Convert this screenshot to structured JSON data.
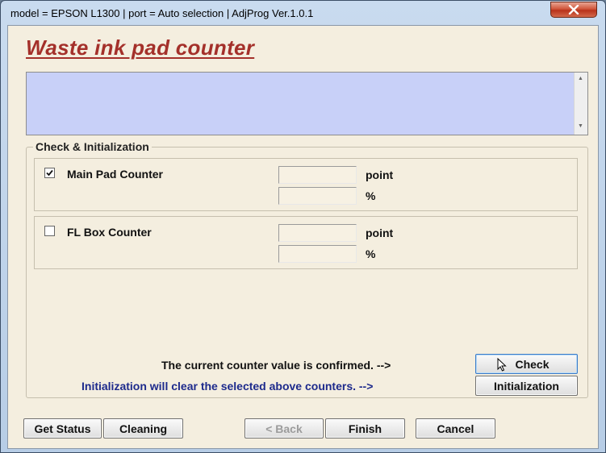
{
  "window": {
    "title": "model = EPSON L1300 | port = Auto selection | AdjProg Ver.1.0.1",
    "close_icon": "close-icon"
  },
  "page": {
    "heading": "Waste ink pad counter",
    "info_text": ""
  },
  "group": {
    "title": "Check & Initialization",
    "counters": [
      {
        "label": "Main Pad Counter",
        "checked": true,
        "point_value": "",
        "percent_value": "",
        "point_unit": "point",
        "percent_unit": "%"
      },
      {
        "label": "FL Box Counter",
        "checked": false,
        "point_value": "",
        "percent_value": "",
        "point_unit": "point",
        "percent_unit": "%"
      }
    ],
    "check_message": "The current counter value is confirmed. -->",
    "init_message": "Initialization will clear the selected above counters. -->",
    "check_button": "Check",
    "init_button": "Initialization"
  },
  "footer": {
    "get_status": "Get Status",
    "cleaning": "Cleaning",
    "back": "< Back",
    "finish": "Finish",
    "cancel": "Cancel"
  },
  "colors": {
    "heading": "#a4302a",
    "info_box": "#c8d0f8",
    "init_message": "#1d2a8c",
    "client_bg": "#f4eedf"
  }
}
